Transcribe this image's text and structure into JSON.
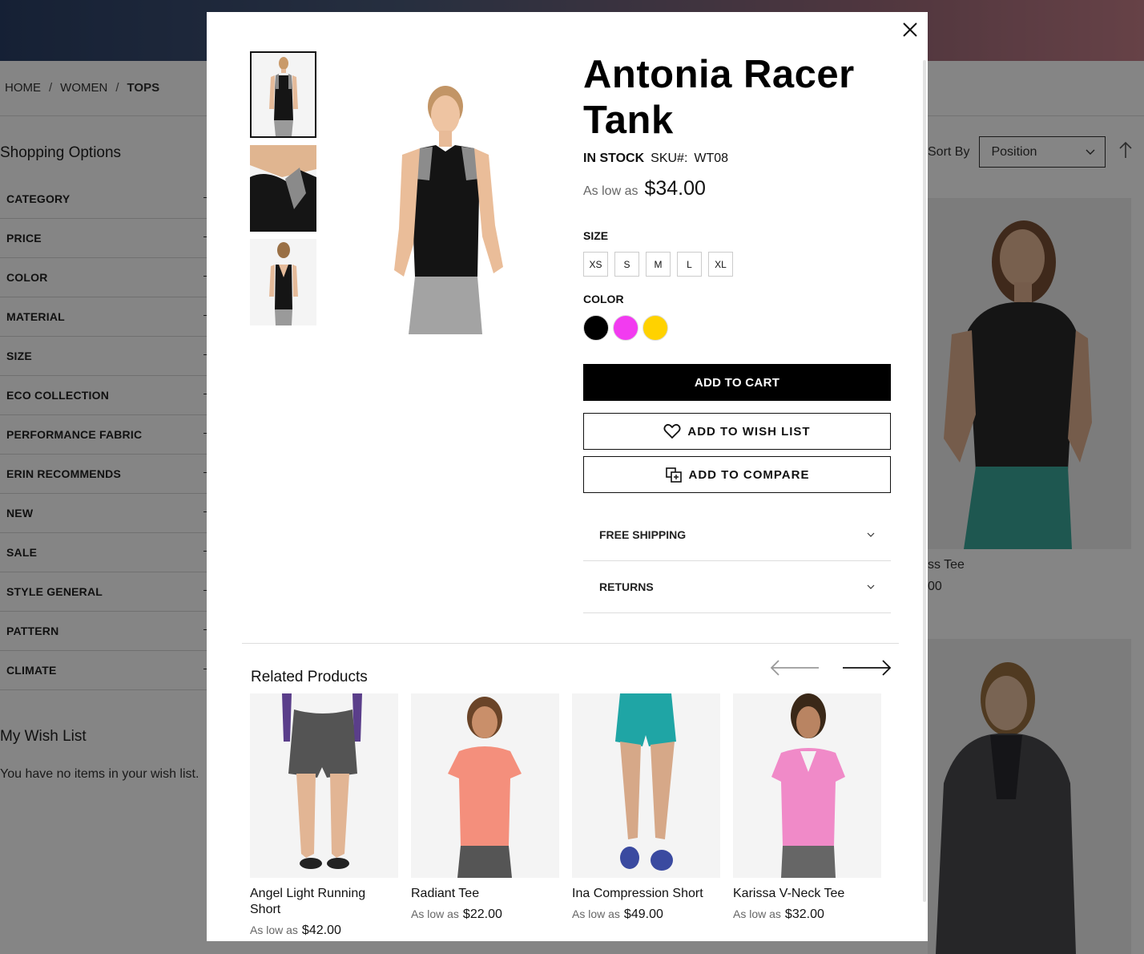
{
  "background": {
    "breadcrumb": [
      "HOME",
      "WOMEN",
      "TOPS"
    ],
    "breadcrumb_sep": "/",
    "shopping_options_title": "Shopping Options",
    "filters": [
      "CATEGORY",
      "PRICE",
      "COLOR",
      "MATERIAL",
      "SIZE",
      "ECO COLLECTION",
      "PERFORMANCE FABRIC",
      "ERIN RECOMMENDS",
      "NEW",
      "SALE",
      "STYLE GENERAL",
      "PATTERN",
      "CLIMATE"
    ],
    "wish_list_title": "My Wish List",
    "wish_list_empty": "You have no items in your wish list.",
    "sort_label": "Sort By",
    "sort_value": "Position",
    "card1_name_fragment": "ss Tee",
    "card1_price_fragment": "00"
  },
  "modal": {
    "product_name": "Antonia Racer Tank",
    "stock": "IN STOCK",
    "sku_label": "SKU#:",
    "sku_value": "WT08",
    "as_low_as": "As low as",
    "price": "$34.00",
    "size_label": "SIZE",
    "sizes": [
      "XS",
      "S",
      "M",
      "L",
      "XL"
    ],
    "color_label": "COLOR",
    "colors": [
      "#000000",
      "#f23bf0",
      "#ffd200"
    ],
    "add_to_cart": "ADD TO CART",
    "add_to_wishlist": "ADD TO WISH LIST",
    "add_to_compare": "ADD TO COMPARE",
    "accordion": [
      "FREE SHIPPING",
      "RETURNS"
    ],
    "related_title": "Related Products",
    "related": [
      {
        "name": "Angel Light Running Short",
        "as_low_as": "As low as",
        "price": "$42.00"
      },
      {
        "name": "Radiant Tee",
        "as_low_as": "As low as",
        "price": "$22.00"
      },
      {
        "name": "Ina Compression Short",
        "as_low_as": "As low as",
        "price": "$49.00"
      },
      {
        "name": "Karissa V-Neck Tee",
        "as_low_as": "As low as",
        "price": "$32.00"
      }
    ]
  }
}
